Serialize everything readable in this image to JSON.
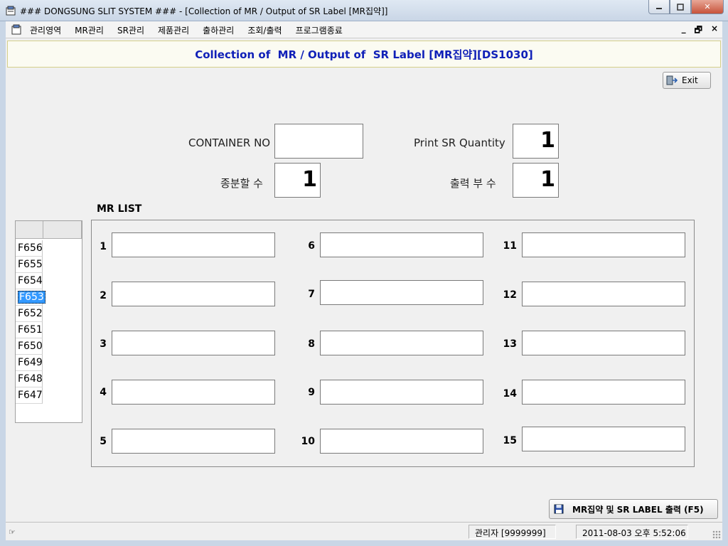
{
  "window": {
    "title": "### DONGSUNG SLIT SYSTEM ### - [Collection of  MR / Output of  SR Label [MR집약]]",
    "minimize_icon": "minimize-icon",
    "maximize_icon": "maximize-icon",
    "close_label": "✕"
  },
  "menubar": {
    "items": [
      "관리영역",
      "MR관리",
      "SR관리",
      "제품관리",
      "출하관리",
      "조회/출력",
      "프로그램종료"
    ],
    "mdi_minimize": "_",
    "mdi_restore": "🗗",
    "mdi_close": "×"
  },
  "header": {
    "title": "Collection of  MR / Output of  SR Label [MR집약][DS1030]"
  },
  "toolbar": {
    "exit_label": "Exit"
  },
  "form": {
    "container_no_label": "CONTAINER NO",
    "container_no_value": "",
    "print_sr_quantity_label": "Print SR Quantity",
    "print_sr_quantity_value": "1",
    "split_count_label": "종분할 수",
    "split_count_value": "1",
    "print_copies_label": "출력 부 수",
    "print_copies_value": "1"
  },
  "mr_list": {
    "title": "MR LIST",
    "slots": [
      "1",
      "2",
      "3",
      "4",
      "5",
      "6",
      "7",
      "8",
      "9",
      "10",
      "11",
      "12",
      "13",
      "14",
      "15"
    ]
  },
  "grid": {
    "rows": [
      "F656",
      "F655",
      "F654",
      "F653",
      "F652",
      "F651",
      "F650",
      "F649",
      "F648",
      "F647"
    ],
    "selected": "F653"
  },
  "action": {
    "label": "MR집약 및 SR LABEL 출력 (F5)"
  },
  "statusbar": {
    "user": "관리자 [9999999]",
    "datetime": "2011-08-03 오후 5:52:06"
  },
  "colors": {
    "header_text": "#1020b8",
    "selection": "#3399ff"
  }
}
